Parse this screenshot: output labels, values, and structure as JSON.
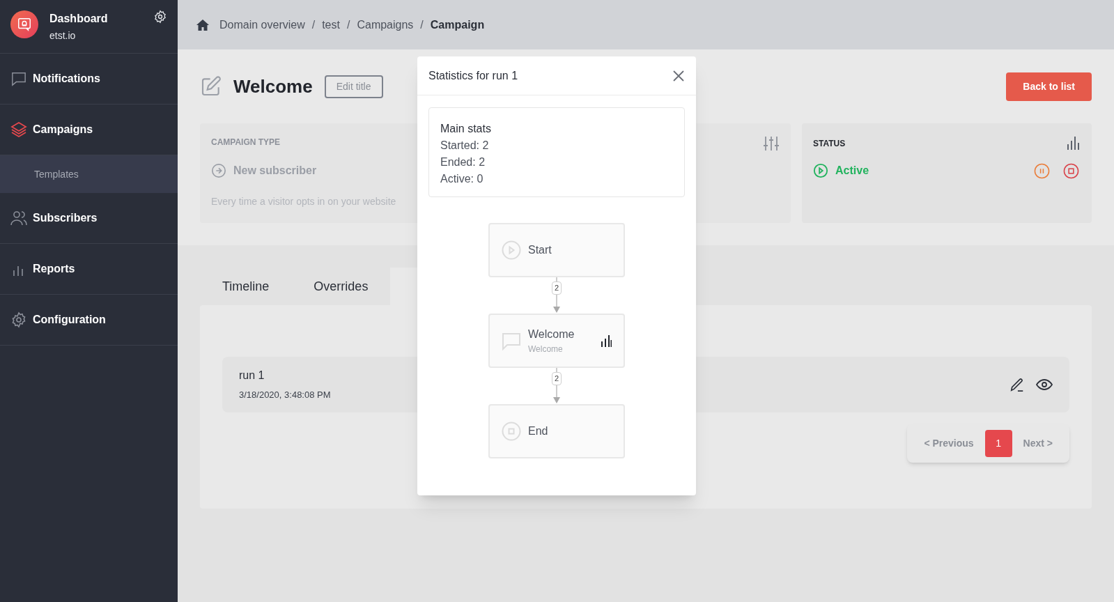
{
  "sidebar": {
    "brand": {
      "title": "Dashboard",
      "subtitle": "etst.io"
    },
    "items": [
      {
        "label": "Notifications",
        "selected": false
      },
      {
        "label": "Campaigns",
        "selected": true,
        "children": [
          {
            "label": "Templates",
            "selected": true
          }
        ]
      },
      {
        "label": "Subscribers",
        "selected": false
      },
      {
        "label": "Reports",
        "selected": false
      },
      {
        "label": "Configuration",
        "selected": false
      }
    ]
  },
  "breadcrumb": {
    "items": [
      {
        "label": "Domain overview",
        "current": false
      },
      {
        "label": "test",
        "current": false
      },
      {
        "label": "Campaigns",
        "current": false
      },
      {
        "label": "Campaign",
        "current": true
      }
    ],
    "separators": [
      "/",
      "/",
      "/"
    ]
  },
  "page": {
    "title": "Welcome",
    "edit_button": "Edit title",
    "back_button": "Back to list"
  },
  "campaign_type": {
    "heading": "CAMPAIGN TYPE",
    "value": "New subscriber",
    "description": "Every time a visitor opts in on your website"
  },
  "status": {
    "heading": "STATUS",
    "value": "Active"
  },
  "tabs": [
    {
      "label": "Timeline",
      "selected": false
    },
    {
      "label": "Overrides",
      "selected": false
    }
  ],
  "runs": [
    {
      "name": "run 1",
      "date": "3/18/2020, 3:48:08 PM"
    }
  ],
  "pagination": {
    "previous": "< Previous",
    "pages": [
      {
        "label": "1",
        "selected": true
      }
    ],
    "next": "Next >"
  },
  "modal": {
    "title": "Statistics for run 1",
    "stats_heading": "Main stats",
    "stats": [
      "Started: 2",
      "Ended: 2",
      "Active: 0"
    ],
    "flow": [
      {
        "kind": "start",
        "title": "Start"
      },
      {
        "kind": "edge",
        "count": "2"
      },
      {
        "kind": "message",
        "title": "Welcome",
        "subtitle": "Welcome"
      },
      {
        "kind": "edge",
        "count": "2"
      },
      {
        "kind": "end",
        "title": "End"
      }
    ]
  }
}
